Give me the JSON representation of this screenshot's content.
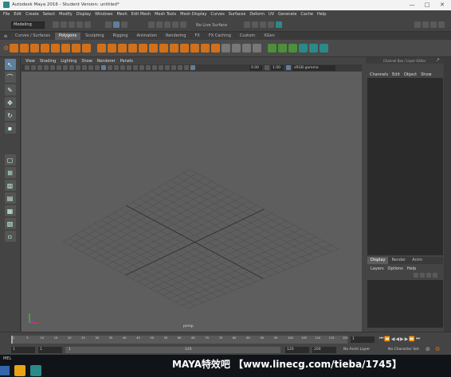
{
  "window": {
    "title": "Autodesk Maya 2016 - Student Version: untitled*",
    "minimize": "—",
    "maximize": "□",
    "close": "✕"
  },
  "menubar": [
    "File",
    "Edit",
    "Create",
    "Select",
    "Modify",
    "Display",
    "Windows",
    "Mesh",
    "Edit Mesh",
    "Mesh Tools",
    "Mesh Display",
    "Curves",
    "Surfaces",
    "Deform",
    "UV",
    "Generate",
    "Cache",
    "Help"
  ],
  "statusline": {
    "mode": "Modeling",
    "live_surface": "No Live Surface"
  },
  "shelf_tabs": [
    {
      "label": "Curves / Surfaces",
      "active": false
    },
    {
      "label": "Polygons",
      "active": true
    },
    {
      "label": "Sculpting",
      "active": false
    },
    {
      "label": "Rigging",
      "active": false
    },
    {
      "label": "Animation",
      "active": false
    },
    {
      "label": "Rendering",
      "active": false
    },
    {
      "label": "FX",
      "active": false
    },
    {
      "label": "FX Caching",
      "active": false
    },
    {
      "label": "Custom",
      "active": false
    },
    {
      "label": "XGen",
      "active": false
    }
  ],
  "viewport_menu": [
    "View",
    "Shading",
    "Lighting",
    "Show",
    "Renderer",
    "Panels"
  ],
  "viewport_toolbar": {
    "near": "0.00",
    "far": "1.00",
    "color_space": "sRGB gamma"
  },
  "viewport_label": "persp",
  "channel_box": {
    "header": "Channel Box / Layer Editor",
    "menu": [
      "Channels",
      "Edit",
      "Object",
      "Show"
    ]
  },
  "layer_editor": {
    "tabs": [
      {
        "label": "Display",
        "active": true
      },
      {
        "label": "Render",
        "active": false
      },
      {
        "label": "Anim",
        "active": false
      }
    ],
    "menu": [
      "Layers",
      "Options",
      "Help"
    ]
  },
  "timeslider": {
    "ticks": [
      "1",
      "5",
      "10",
      "15",
      "20",
      "25",
      "30",
      "35",
      "40",
      "45",
      "50",
      "55",
      "60",
      "65",
      "70",
      "75",
      "80",
      "85",
      "90",
      "95",
      "100",
      "105",
      "110",
      "115",
      "120"
    ],
    "current_frame": "1"
  },
  "range": {
    "start": "1",
    "playback_start": "1",
    "slider_start": "1",
    "slider_end": "120",
    "playback_end": "120",
    "end": "200",
    "anim_layer": "No Anim Layer",
    "character_set": "No Character Set"
  },
  "command_line": {
    "lang": "MEL"
  },
  "watermark": "MAYA特效吧 【www.linecg.com/tieba/1745】"
}
